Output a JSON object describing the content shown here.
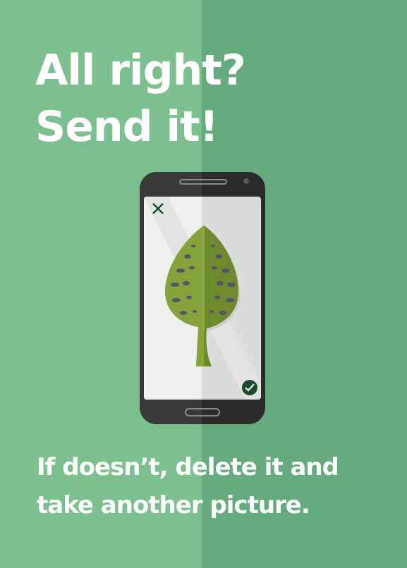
{
  "headline": {
    "line1": "All right?",
    "line2": "Send it!"
  },
  "subtext": {
    "line1": "If doesn’t, delete it and",
    "line2": "take another picture."
  },
  "phone": {
    "close_icon": "close-icon",
    "confirm_icon": "check-icon",
    "subject": "leaf"
  },
  "colors": {
    "background_left": "#7cc08f",
    "background_right": "#65ab7e",
    "text": "#ffffff",
    "phone_body": "#2b2b2b",
    "screen": "#e9e9e7",
    "leaf": "#7f9a34",
    "leaf_spots": "#50506b",
    "confirm": "#1d4a2c"
  }
}
